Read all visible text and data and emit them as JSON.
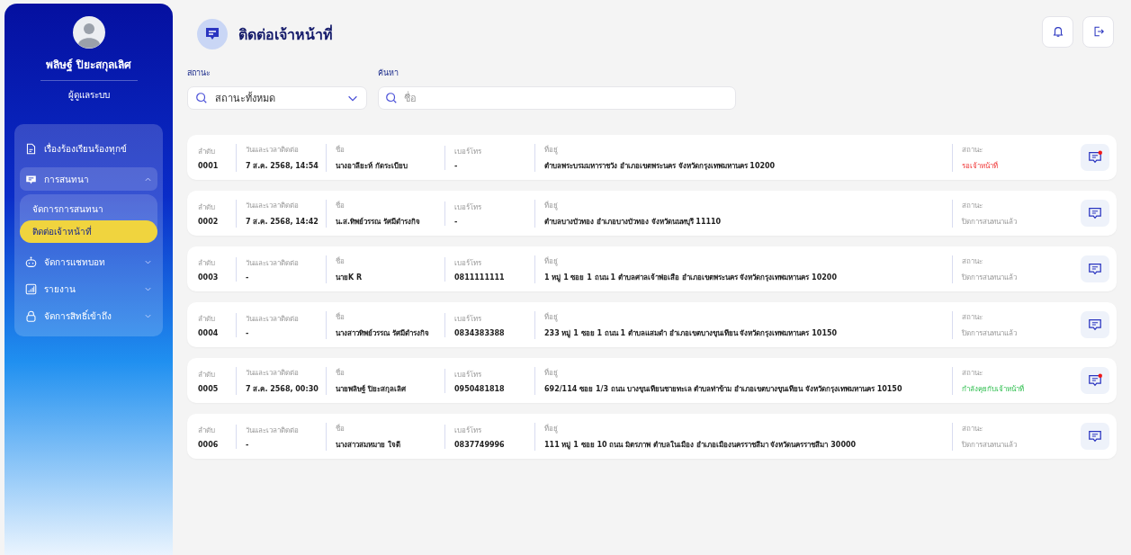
{
  "user": {
    "name": "พลิษฐ์ ปิยะสกุลเลิศ",
    "role": "ผู้ดูแลระบบ"
  },
  "sidebar": {
    "items": [
      {
        "label": "เรื่องร้องเรียนร้องทุกข์"
      },
      {
        "label": "การสนทนา",
        "expanded": true,
        "children": [
          {
            "label": "จัดการการสนทนา",
            "selected": false
          },
          {
            "label": "ติดต่อเจ้าหน้าที่",
            "selected": true
          }
        ]
      },
      {
        "label": "จัดการแชทบอท",
        "expanded": false
      },
      {
        "label": "รายงาน",
        "expanded": false
      },
      {
        "label": "จัดการสิทธิ์เข้าถึง",
        "expanded": false
      }
    ]
  },
  "page": {
    "title": "ติดต่อเจ้าหน้าที่"
  },
  "filters": {
    "status_label": "สถานะ",
    "status_value": "สถานะทั้งหมด",
    "search_label": "ค้นหา",
    "search_placeholder": "ชื่อ"
  },
  "rows": [
    {
      "cells": [
        {
          "label": "ลำดับ",
          "value": "0001"
        },
        {
          "label": "วันและเวลาติดต่อ",
          "value": "7 ส.ค. 2568, 14:54"
        },
        {
          "label": "ชื่อ",
          "value": "นางอาลียะห์ กัดระเบียบ"
        },
        {
          "label": "เบอร์โทร",
          "value": "-"
        },
        {
          "label": "ที่อยู่",
          "value": "ตำบลพระบรมมหาราชวัง อำเภอเขตพระนคร จังหวัดกรุงเทพมหานคร 10200"
        }
      ],
      "status_label": "สถานะ",
      "status": "รอเจ้าหน้าที่",
      "kind": "waiting",
      "unread": true
    },
    {
      "cells": [
        {
          "label": "ลำดับ",
          "value": "0002"
        },
        {
          "label": "วันและเวลาติดต่อ",
          "value": "7 ส.ค. 2568, 14:42"
        },
        {
          "label": "ชื่อ",
          "value": "น.ส.ทิพย์วรรณ รัศมีดำรงกิจ"
        },
        {
          "label": "เบอร์โทร",
          "value": "-"
        },
        {
          "label": "ที่อยู่",
          "value": "ตำบลบางบัวทอง อำเภอบางบัวทอง จังหวัดนนทบุรี 11110"
        }
      ],
      "status_label": "สถานะ",
      "status": "ปิดการสนทนาแล้ว",
      "kind": "closed",
      "unread": false
    },
    {
      "cells": [
        {
          "label": "ลำดับ",
          "value": "0003"
        },
        {
          "label": "วันและเวลาติดต่อ",
          "value": "-"
        },
        {
          "label": "ชื่อ",
          "value": "นายK R"
        },
        {
          "label": "เบอร์โทร",
          "value": "0811111111"
        },
        {
          "label": "ที่อยู่",
          "value": "1 หมู่ 1 ซอย 1 ถนน 1 ตำบลศาลเจ้าพ่อเสือ อำเภอเขตพระนคร จังหวัดกรุงเทพมหานคร 10200"
        }
      ],
      "status_label": "สถานะ",
      "status": "ปิดการสนทนาแล้ว",
      "kind": "closed",
      "unread": false
    },
    {
      "cells": [
        {
          "label": "ลำดับ",
          "value": "0004"
        },
        {
          "label": "วันและเวลาติดต่อ",
          "value": "-"
        },
        {
          "label": "ชื่อ",
          "value": "นางสาวทิพย์วรรณ รัศมีดำรงกิจ"
        },
        {
          "label": "เบอร์โทร",
          "value": "0834383388"
        },
        {
          "label": "ที่อยู่",
          "value": "233 หมู่ 1 ซอย 1 ถนน 1 ตำบลแสมดำ อำเภอเขตบางขุนเทียน จังหวัดกรุงเทพมหานคร 10150"
        }
      ],
      "status_label": "สถานะ",
      "status": "ปิดการสนทนาแล้ว",
      "kind": "closed",
      "unread": false
    },
    {
      "cells": [
        {
          "label": "ลำดับ",
          "value": "0005"
        },
        {
          "label": "วันและเวลาติดต่อ",
          "value": "7 ส.ค. 2568, 00:30"
        },
        {
          "label": "ชื่อ",
          "value": "นายพลิษฐ์ ปิยะสกุลเลิศ"
        },
        {
          "label": "เบอร์โทร",
          "value": "0950481818"
        },
        {
          "label": "ที่อยู่",
          "value": "692/114 ซอย 1/3 ถนน บางขุนเทียนชายทะเล ตำบลท่าข้าม อำเภอเขตบางขุนเทียน จังหวัดกรุงเทพมหานคร 10150"
        }
      ],
      "status_label": "สถานะ",
      "status": "กำลังคุยกับเจ้าหน้าที่",
      "kind": "active",
      "unread": true
    },
    {
      "cells": [
        {
          "label": "ลำดับ",
          "value": "0006"
        },
        {
          "label": "วันและเวลาติดต่อ",
          "value": "-"
        },
        {
          "label": "ชื่อ",
          "value": "นางสาวสมหมาย ใจดี"
        },
        {
          "label": "เบอร์โทร",
          "value": "0837749996"
        },
        {
          "label": "ที่อยู่",
          "value": "111 หมู่ 1 ซอย 10 ถนน มิตรภาพ ตำบลในเมือง อำเภอเมืองนครราชสีมา จังหวัดนครราชสีมา 30000"
        }
      ],
      "status_label": "สถานะ",
      "status": "ปิดการสนทนาแล้ว",
      "kind": "closed",
      "unread": false
    }
  ]
}
